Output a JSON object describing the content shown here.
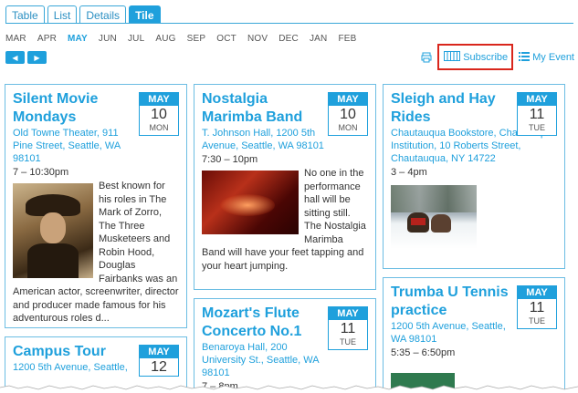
{
  "tabs": [
    {
      "label": "Table",
      "active": false
    },
    {
      "label": "List",
      "active": false
    },
    {
      "label": "Details",
      "active": false
    },
    {
      "label": "Tile",
      "active": true
    }
  ],
  "months": [
    "MAR",
    "APR",
    "MAY",
    "JUN",
    "JUL",
    "AUG",
    "SEP",
    "OCT",
    "NOV",
    "DEC",
    "JAN",
    "FEB"
  ],
  "current_month": "MAY",
  "nav": {
    "prev": "◀",
    "next": "▶"
  },
  "toolbar": {
    "subscribe_label": "Subscribe",
    "my_events_label": "My Event",
    "print_icon": "printer-icon",
    "subscribe_icon": "calendar-grid-icon",
    "my_events_icon": "list-icon"
  },
  "colors": {
    "accent": "#1fa0dc",
    "highlight_border": "#d9261c",
    "card_border": "#6cbde3"
  },
  "events": [
    {
      "title": "Silent Movie Mondays",
      "location": "Old Towne Theater, 911 Pine Street, Seattle, WA 98101",
      "time": "7 – 10:30pm",
      "month": "MAY",
      "day": "10",
      "weekday": "MON",
      "description": "Best known for his roles in The Mark of Zorro, The Three Musketeers and Robin Hood, Douglas Fairbanks was an American actor, screenwriter, director and producer made famous for his adventurous roles d..."
    },
    {
      "title": "Nostalgia Marimba Band",
      "location": "T. Johnson Hall, 1200 5th Avenue, Seattle, WA 98101",
      "time": "7:30 – 10pm",
      "month": "MAY",
      "day": "10",
      "weekday": "MON",
      "description": "No one in the performance hall will be sitting still. The Nostalgia Marimba Band will have your feet tapping and your heart jumping."
    },
    {
      "title": "Sleigh and Hay Rides",
      "location": "Chautauqua Bookstore, Chautauqua Institution, 10 Roberts Street, Chautauqua, NY 14722",
      "time": "3 – 4pm",
      "month": "MAY",
      "day": "11",
      "weekday": "TUE",
      "description": ""
    },
    {
      "title": "Campus Tour",
      "location": "1200 5th Avenue, Seattle,",
      "time": "",
      "month": "MAY",
      "day": "12",
      "weekday": "",
      "description": ""
    },
    {
      "title": "Mozart's Flute Concerto No.1",
      "location": "Benaroya Hall, 200 University St., Seattle, WA 98101",
      "time": "7 – 8pm",
      "month": "MAY",
      "day": "11",
      "weekday": "TUE",
      "description": ""
    },
    {
      "title": "Trumba U Tennis practice",
      "location": "1200 5th Avenue, Seattle, WA 98101",
      "time": "5:35 – 6:50pm",
      "month": "MAY",
      "day": "11",
      "weekday": "TUE",
      "description": ""
    }
  ]
}
